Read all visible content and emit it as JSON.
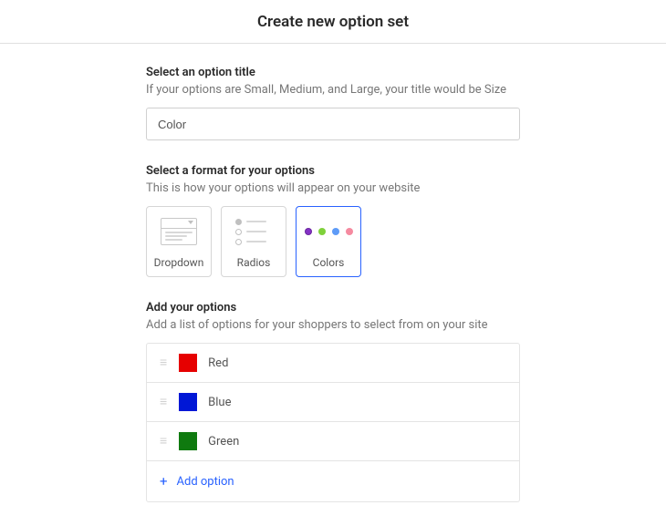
{
  "header": {
    "title": "Create new option set"
  },
  "title_section": {
    "label": "Select an option title",
    "hint": "If your options are Small, Medium, and Large, your title would be Size",
    "value": "Color"
  },
  "format_section": {
    "label": "Select a format for your options",
    "hint": "This is how your options will appear on your website",
    "cards": [
      {
        "key": "dropdown",
        "label": "Dropdown",
        "selected": false
      },
      {
        "key": "radios",
        "label": "Radios",
        "selected": false
      },
      {
        "key": "colors",
        "label": "Colors",
        "selected": true
      }
    ],
    "color_dots": [
      "#8531c6",
      "#7fd13b",
      "#5e9bf7",
      "#f58aa0"
    ]
  },
  "options_section": {
    "label": "Add your options",
    "hint": "Add a list of options for your shoppers to select from on your site",
    "items": [
      {
        "label": "Red",
        "color": "#e60000"
      },
      {
        "label": "Blue",
        "color": "#0017d6"
      },
      {
        "label": "Green",
        "color": "#0f7a0f"
      }
    ],
    "add_label": "Add option"
  }
}
